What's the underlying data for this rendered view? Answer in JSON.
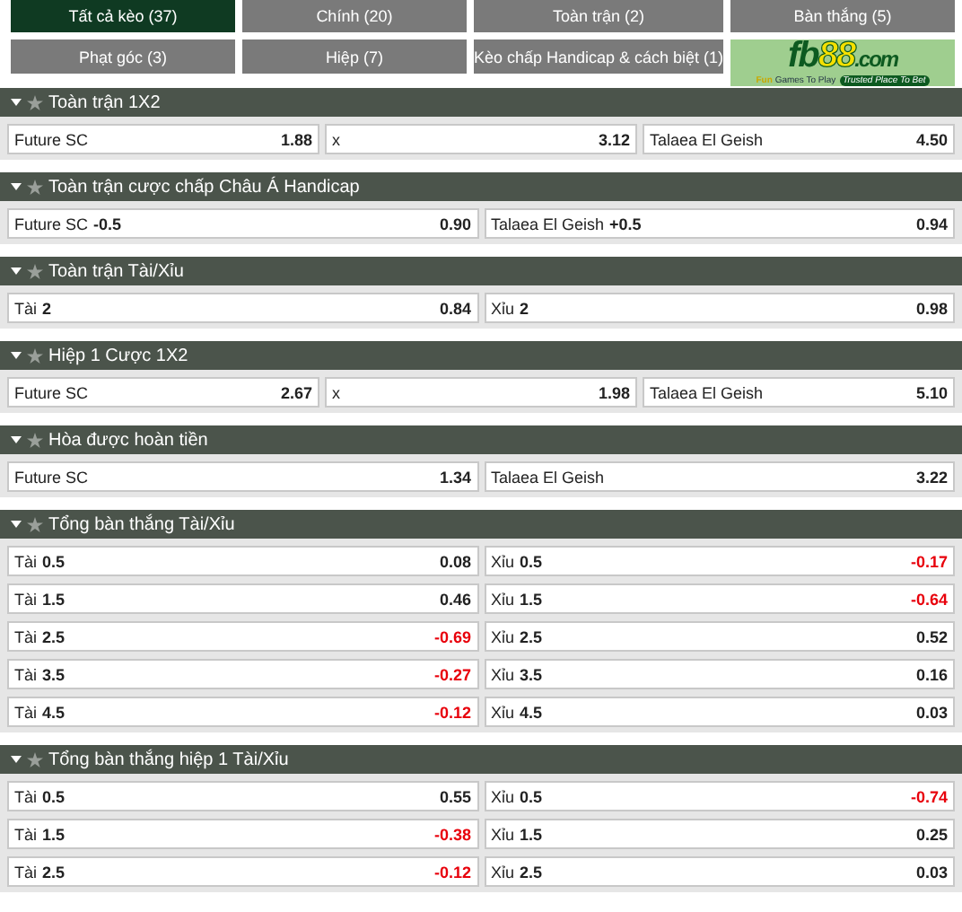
{
  "tabs": [
    {
      "label": "Tất cả kèo (37)",
      "selected": true
    },
    {
      "label": "Chính (20)",
      "selected": false
    },
    {
      "label": "Toàn trận (2)",
      "selected": false
    },
    {
      "label": "Bàn thắng (5)",
      "selected": false
    },
    {
      "label": "Phạt góc (3)",
      "selected": false
    },
    {
      "label": "Hiệp (7)",
      "selected": false
    },
    {
      "label": "Kèo chấp Handicap & cách biệt (1)",
      "selected": false
    }
  ],
  "logo": {
    "brand": "fb88",
    "domain": ".com",
    "tagline_fun": "Fun",
    "tagline": "Games To Play",
    "badge": "Trusted Place To Bet"
  },
  "markets": [
    {
      "title": "Toàn trận 1X2",
      "rows": [
        [
          {
            "name": "Future SC",
            "odds": "1.88",
            "negative": false
          },
          {
            "name": "x",
            "odds": "3.12",
            "negative": false
          },
          {
            "name": "Talaea El Geish",
            "odds": "4.50",
            "negative": false
          }
        ]
      ]
    },
    {
      "title": "Toàn trận cược chấp Châu Á Handicap",
      "rows": [
        [
          {
            "name": "Future SC",
            "line": "-0.5",
            "odds": "0.90",
            "negative": false
          },
          {
            "name": "Talaea El Geish",
            "line": "+0.5",
            "odds": "0.94",
            "negative": false
          }
        ]
      ]
    },
    {
      "title": "Toàn trận Tài/Xỉu",
      "rows": [
        [
          {
            "name": "Tài",
            "line": "2",
            "odds": "0.84",
            "negative": false
          },
          {
            "name": "Xỉu",
            "line": "2",
            "odds": "0.98",
            "negative": false
          }
        ]
      ]
    },
    {
      "title": "Hiệp 1 Cược 1X2",
      "rows": [
        [
          {
            "name": "Future SC",
            "odds": "2.67",
            "negative": false
          },
          {
            "name": "x",
            "odds": "1.98",
            "negative": false
          },
          {
            "name": "Talaea El Geish",
            "odds": "5.10",
            "negative": false
          }
        ]
      ]
    },
    {
      "title": "Hòa được hoàn tiền",
      "rows": [
        [
          {
            "name": "Future SC",
            "odds": "1.34",
            "negative": false
          },
          {
            "name": "Talaea El Geish",
            "odds": "3.22",
            "negative": false
          }
        ]
      ]
    },
    {
      "title": "Tổng bàn thắng Tài/Xỉu",
      "rows": [
        [
          {
            "name": "Tài",
            "line": "0.5",
            "odds": "0.08",
            "negative": false
          },
          {
            "name": "Xỉu",
            "line": "0.5",
            "odds": "-0.17",
            "negative": true
          }
        ],
        [
          {
            "name": "Tài",
            "line": "1.5",
            "odds": "0.46",
            "negative": false
          },
          {
            "name": "Xỉu",
            "line": "1.5",
            "odds": "-0.64",
            "negative": true
          }
        ],
        [
          {
            "name": "Tài",
            "line": "2.5",
            "odds": "-0.69",
            "negative": true
          },
          {
            "name": "Xỉu",
            "line": "2.5",
            "odds": "0.52",
            "negative": false
          }
        ],
        [
          {
            "name": "Tài",
            "line": "3.5",
            "odds": "-0.27",
            "negative": true
          },
          {
            "name": "Xỉu",
            "line": "3.5",
            "odds": "0.16",
            "negative": false
          }
        ],
        [
          {
            "name": "Tài",
            "line": "4.5",
            "odds": "-0.12",
            "negative": true
          },
          {
            "name": "Xỉu",
            "line": "4.5",
            "odds": "0.03",
            "negative": false
          }
        ]
      ]
    },
    {
      "title": "Tổng bàn thắng hiệp 1 Tài/Xỉu",
      "rows": [
        [
          {
            "name": "Tài",
            "line": "0.5",
            "odds": "0.55",
            "negative": false
          },
          {
            "name": "Xỉu",
            "line": "0.5",
            "odds": "-0.74",
            "negative": true
          }
        ],
        [
          {
            "name": "Tài",
            "line": "1.5",
            "odds": "-0.38",
            "negative": true
          },
          {
            "name": "Xỉu",
            "line": "1.5",
            "odds": "0.25",
            "negative": false
          }
        ],
        [
          {
            "name": "Tài",
            "line": "2.5",
            "odds": "-0.12",
            "negative": true
          },
          {
            "name": "Xỉu",
            "line": "2.5",
            "odds": "0.03",
            "negative": false
          }
        ]
      ]
    }
  ]
}
